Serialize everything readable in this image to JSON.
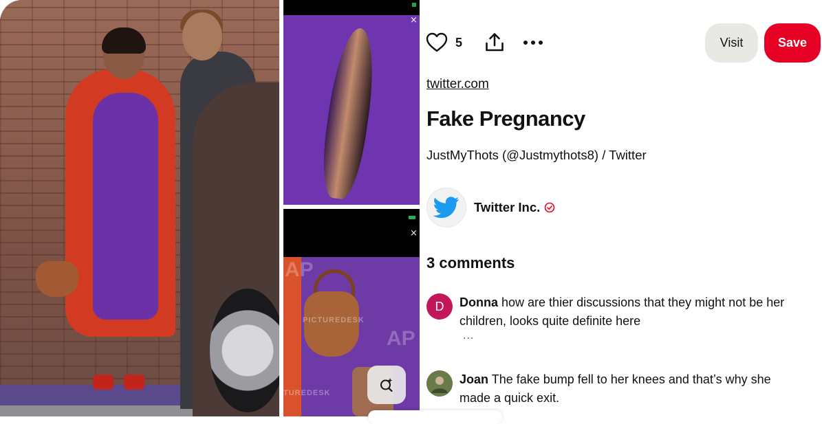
{
  "actions": {
    "like_count": "5",
    "visit_label": "Visit",
    "save_label": "Save"
  },
  "pin": {
    "source": "twitter.com",
    "title": "Fake Pregnancy",
    "description": "JustMyThots (@Justmythots8) / Twitter"
  },
  "creator": {
    "name": "Twitter Inc.",
    "verified": true
  },
  "comments": {
    "heading": "3 comments",
    "items": [
      {
        "author": "Donna",
        "avatar_letter": "D",
        "avatar_color": "#c2185b",
        "text": "how are thier discussions that they might not be her children, looks quite definite here",
        "more": "..."
      },
      {
        "author": "Joan",
        "avatar_color": "#6b7a4a",
        "text": "The fake bump fell to her knees and that’s why she made a quick exit."
      }
    ]
  },
  "image": {
    "close_glyph_top": "×",
    "close_glyph_bottom": "×",
    "watermark": "PICTUREDESK",
    "watermark_partial": "TUREDESK",
    "watermark_mark": "AP"
  },
  "colors": {
    "save_red": "#e60023",
    "visit_gray": "#e9e9e4",
    "twitter_blue": "#1d9bf0",
    "verified_red": "#e60023"
  },
  "icons": [
    "heart-icon",
    "share-icon",
    "more-icon",
    "twitter-bird-icon",
    "verified-icon",
    "visual-search-icon"
  ]
}
